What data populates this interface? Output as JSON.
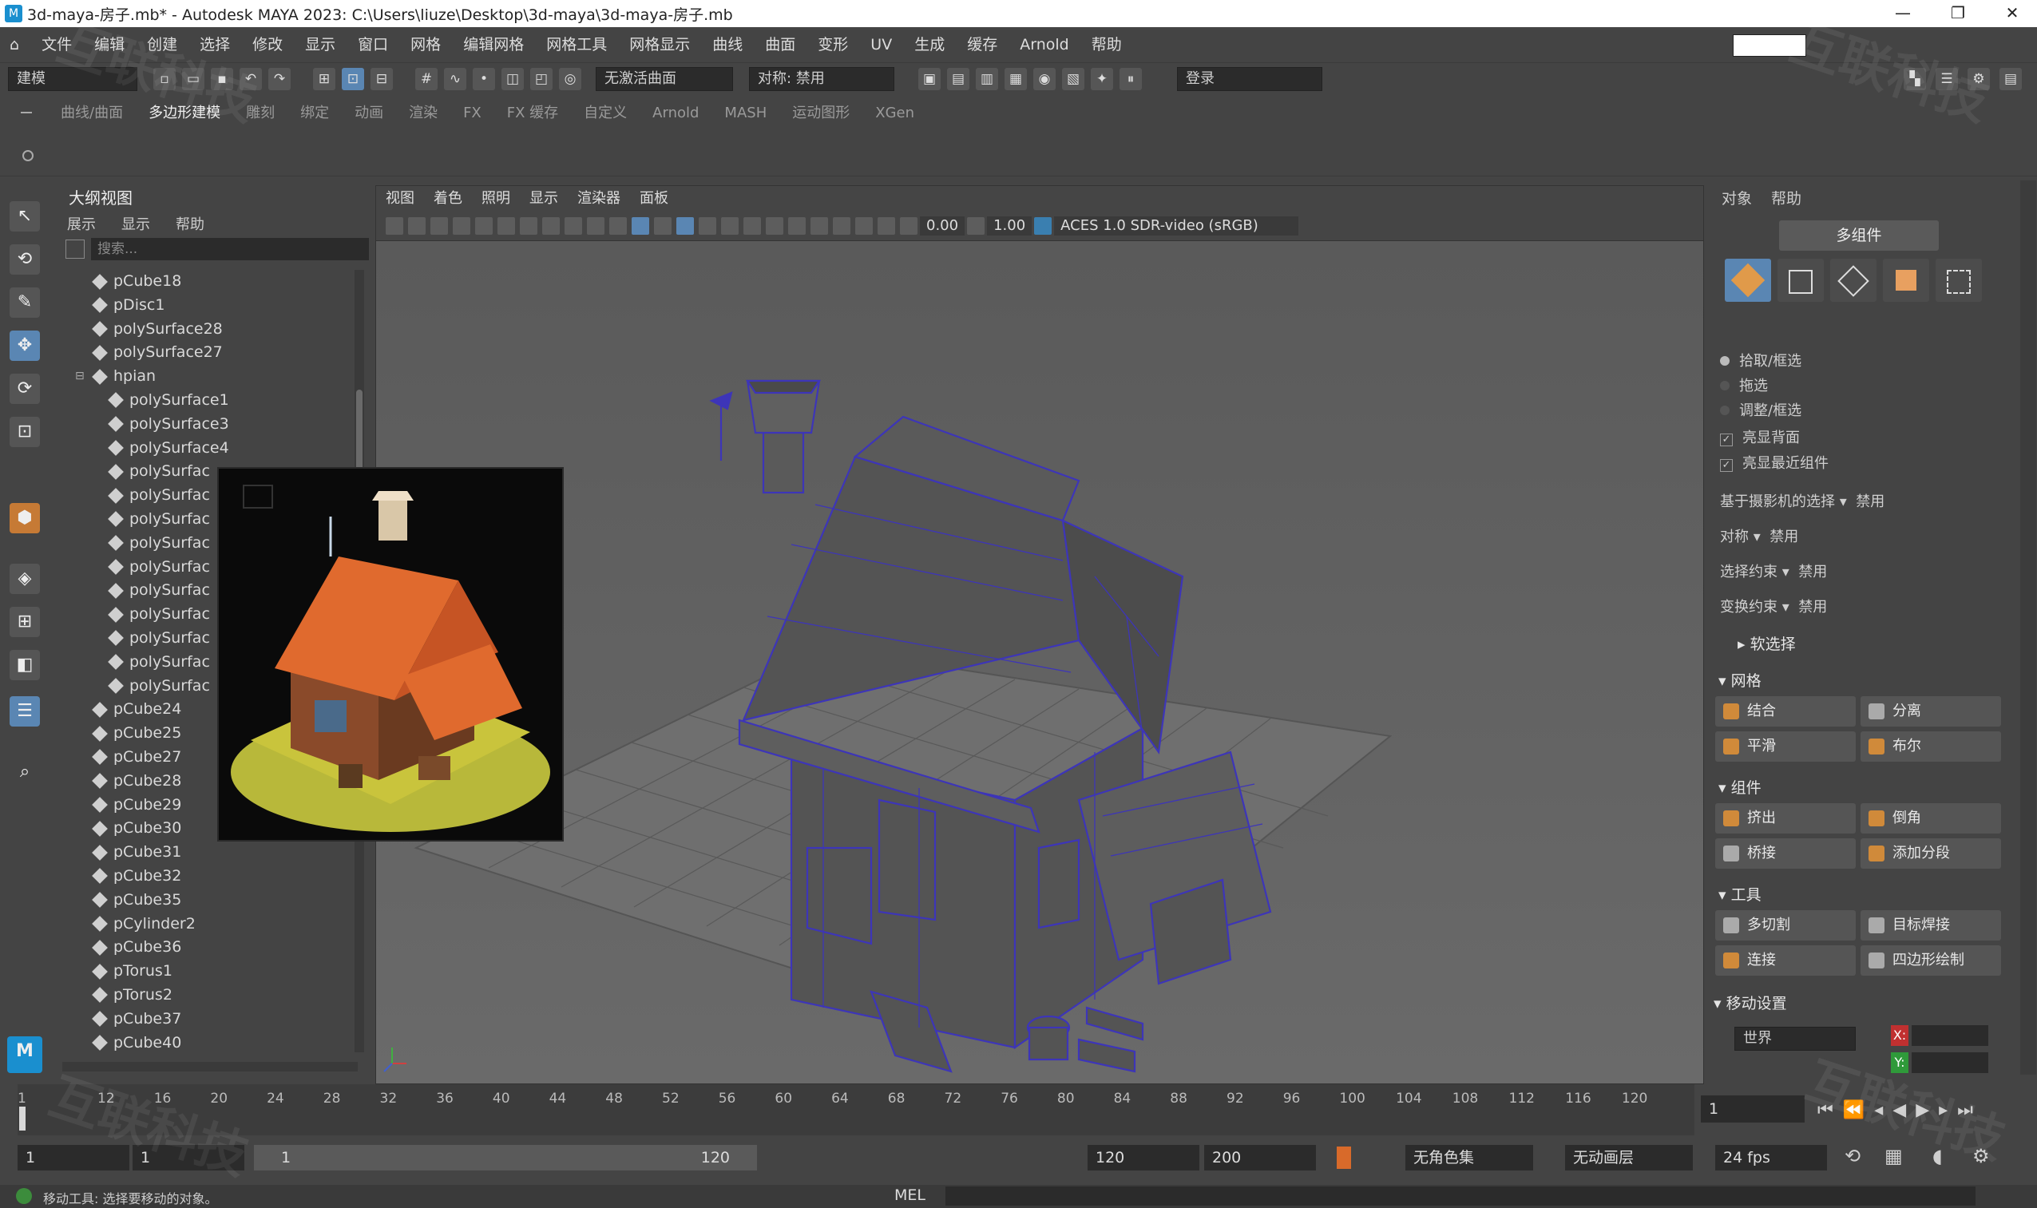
{
  "title": "3d-maya-房子.mb* - Autodesk MAYA 2023: C:\\Users\\liuze\\Desktop\\3d-maya\\3d-maya-房子.mb",
  "menus": [
    "文件",
    "编辑",
    "创建",
    "选择",
    "修改",
    "显示",
    "窗口",
    "网格",
    "编辑网格",
    "网格工具",
    "网格显示",
    "曲线",
    "曲面",
    "变形",
    "UV",
    "生成",
    "缓存",
    "Arnold",
    "帮助"
  ],
  "status": {
    "mode": "建模",
    "live_surface": "无激活曲面",
    "symmetry": "对称: 禁用",
    "login": "登录"
  },
  "shelf_tabs": [
    "曲线/曲面",
    "多边形建模",
    "雕刻",
    "绑定",
    "动画",
    "渲染",
    "FX",
    "FX 缓存",
    "自定义",
    "Arnold",
    "MASH",
    "运动图形",
    "XGen"
  ],
  "outliner": {
    "title": "大纲视图",
    "menus": [
      "展示",
      "显示",
      "帮助"
    ],
    "search_placeholder": "搜索...",
    "nodes": [
      {
        "label": "pCube18",
        "depth": 0
      },
      {
        "label": "pDisc1",
        "depth": 0
      },
      {
        "label": "polySurface28",
        "depth": 0
      },
      {
        "label": "polySurface27",
        "depth": 0
      },
      {
        "label": "hpian",
        "depth": 0,
        "group": true
      },
      {
        "label": "polySurface1",
        "depth": 1
      },
      {
        "label": "polySurface3",
        "depth": 1
      },
      {
        "label": "polySurface4",
        "depth": 1
      },
      {
        "label": "polySurfac",
        "depth": 1
      },
      {
        "label": "polySurfac",
        "depth": 1
      },
      {
        "label": "polySurfac",
        "depth": 1
      },
      {
        "label": "polySurfac",
        "depth": 1
      },
      {
        "label": "polySurfac",
        "depth": 1
      },
      {
        "label": "polySurfac",
        "depth": 1
      },
      {
        "label": "polySurfac",
        "depth": 1
      },
      {
        "label": "polySurfac",
        "depth": 1
      },
      {
        "label": "polySurfac",
        "depth": 1
      },
      {
        "label": "polySurfac",
        "depth": 1
      },
      {
        "label": "pCube24",
        "depth": 0
      },
      {
        "label": "pCube25",
        "depth": 0
      },
      {
        "label": "pCube27",
        "depth": 0
      },
      {
        "label": "pCube28",
        "depth": 0
      },
      {
        "label": "pCube29",
        "depth": 0
      },
      {
        "label": "pCube30",
        "depth": 0
      },
      {
        "label": "pCube31",
        "depth": 0
      },
      {
        "label": "pCube32",
        "depth": 0
      },
      {
        "label": "pCube35",
        "depth": 0
      },
      {
        "label": "pCylinder2",
        "depth": 0
      },
      {
        "label": "pCube36",
        "depth": 0
      },
      {
        "label": "pTorus1",
        "depth": 0
      },
      {
        "label": "pTorus2",
        "depth": 0
      },
      {
        "label": "pCube37",
        "depth": 0
      },
      {
        "label": "pCube40",
        "depth": 0
      }
    ]
  },
  "viewport": {
    "menus": [
      "视图",
      "着色",
      "照明",
      "显示",
      "渲染器",
      "面板"
    ],
    "exposure": "0.00",
    "gamma": "1.00",
    "colorspace": "ACES 1.0 SDR-video (sRGB)",
    "camera": "persp"
  },
  "toolkit": {
    "tabs": [
      "对象",
      "帮助"
    ],
    "multi": "多组件",
    "options": [
      {
        "label": "拾取/框选",
        "type": "radio",
        "on": true
      },
      {
        "label": "拖选",
        "type": "radio",
        "on": false
      },
      {
        "label": "调整/框选",
        "type": "radio",
        "on": false
      },
      {
        "label": "亮显背面",
        "type": "check",
        "on": true
      },
      {
        "label": "亮显最近组件",
        "type": "check",
        "on": true
      }
    ],
    "props": [
      {
        "label": "基于摄影机的选择",
        "value": "禁用"
      },
      {
        "label": "对称",
        "value": "禁用"
      },
      {
        "label": "选择约束",
        "value": "禁用"
      },
      {
        "label": "变换约束",
        "value": "禁用"
      }
    ],
    "soft_select": "软选择",
    "sections": {
      "mesh": {
        "title": "网格",
        "buttons": [
          "结合",
          "分离",
          "平滑",
          "布尔"
        ]
      },
      "components": {
        "title": "组件",
        "buttons": [
          "挤出",
          "倒角",
          "桥接",
          "添加分段"
        ]
      },
      "tools": {
        "title": "工具",
        "buttons": [
          "多切割",
          "目标焊接",
          "连接",
          "四边形绘制"
        ]
      }
    },
    "move_settings": {
      "title": "移动设置",
      "space": "世界",
      "x": "X:",
      "y": "Y:"
    }
  },
  "timeline": {
    "ticks": [
      "1",
      "12",
      "16",
      "20",
      "24",
      "28",
      "32",
      "36",
      "40",
      "44",
      "48",
      "52",
      "56",
      "60",
      "64",
      "68",
      "72",
      "76",
      "80",
      "84",
      "88",
      "92",
      "96",
      "100",
      "104",
      "108",
      "112",
      "116",
      "120"
    ],
    "current": "1",
    "range_start": "1",
    "playback_start": "1",
    "range_label_start": "1",
    "range_label_end": "120",
    "playback_end": "120",
    "anim_end": "200",
    "char_set": "无角色集",
    "anim_layer": "无动画层",
    "fps": "24 fps"
  },
  "helpline": {
    "message": "移动工具: 选择要移动的对象。",
    "cmd_lang": "MEL"
  },
  "colors": {
    "wire": "#3d35b8",
    "accent": "#5a86b3",
    "ui_bg": "#444444"
  }
}
